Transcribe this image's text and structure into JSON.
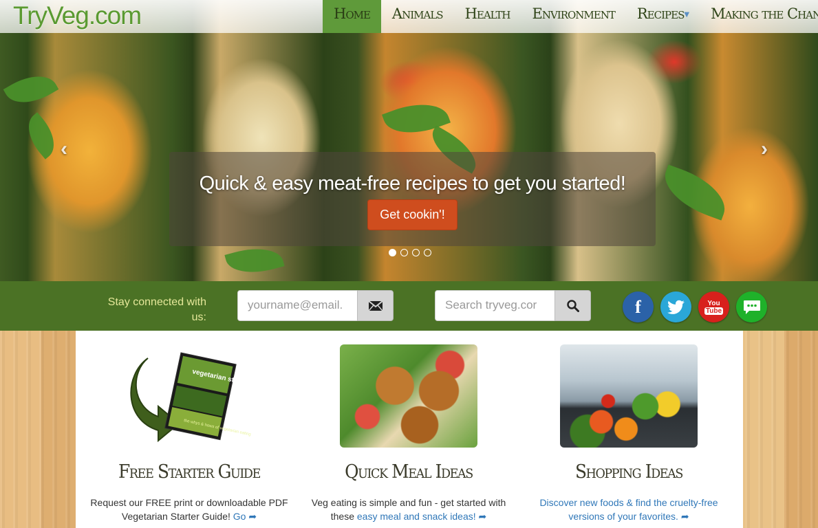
{
  "brand": {
    "logo": "TryVeg.com"
  },
  "nav": {
    "items": [
      {
        "label": "Home"
      },
      {
        "label": "Animals"
      },
      {
        "label": "Health"
      },
      {
        "label": "Environment"
      },
      {
        "label": "Recipes"
      },
      {
        "label": "Making the Change"
      }
    ]
  },
  "hero": {
    "caption": "Quick & easy meat-free recipes to get you started!",
    "cta": "Get cookin'!",
    "prev_icon": "chevron-left-icon",
    "next_icon": "chevron-right-icon"
  },
  "connect": {
    "label": "Stay connected with us:",
    "email_placeholder": "yourname@email.",
    "email_icon": "envelope-icon",
    "search_placeholder": "Search tryveg.cor",
    "search_icon": "search-icon",
    "facebook": "f",
    "youtube_you": "You",
    "youtube_tube": "Tube"
  },
  "cards": [
    {
      "title": "Free Starter Guide",
      "text_1": "Request our FREE print or downloadable PDF Vegetarian Starter Guide!",
      "link": "Go",
      "cover_title": "vegetarian starter guide",
      "cover_sub": "the whys & hows of vegetarian eating"
    },
    {
      "title": "Quick Meal Ideas",
      "text_1": "Veg eating is simple and fun - get started with these",
      "link": "easy meal and snack ideas!"
    },
    {
      "title": "Shopping Ideas",
      "link": "Discover new foods & find the cruelty-free versions of your favorites."
    }
  ],
  "colors": {
    "brand_green": "#5a9a31",
    "bar_green": "#4b7225",
    "cta_orange": "#cf4d1e",
    "link_blue": "#2f77b8"
  }
}
